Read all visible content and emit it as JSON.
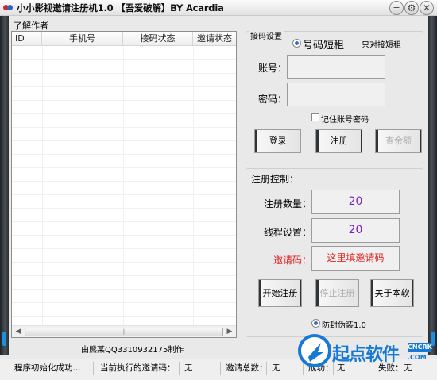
{
  "window": {
    "title": "小小影视邀请注册机1.0 【吾爱破解】BY Acardia",
    "buttons": [
      "−",
      "⚙",
      "✕"
    ]
  },
  "menu": {
    "items": [
      "了解作者"
    ]
  },
  "list": {
    "columns": [
      "ID",
      "手机号",
      "接码状态",
      "邀请状态"
    ],
    "scroll_thumb": "|||"
  },
  "credit": "由熊某QQ3310932175制作",
  "login_panel": {
    "title": "接码设置",
    "radio_sms": "号码短租",
    "radio_only": "只对接短租",
    "account_label": "账号：",
    "password_label": "密码：",
    "account_value": "",
    "password_value": "",
    "remember_label": "记住账号密码",
    "login_button": "登录",
    "register_button": "注册",
    "balance_button": "查余额"
  },
  "register_panel": {
    "title": "注册控制：",
    "count_label": "注册数量：",
    "count_value": "20",
    "thread_label": "线程设置：",
    "thread_value": "20",
    "invite_label": "邀请码：",
    "invite_value": "这里填邀请码",
    "start_button": "开始注册",
    "stop_button": "停止注册",
    "about_button": "关于本软",
    "antifake_label": "防封伪装1.0"
  },
  "status": {
    "message": "程序初始化成功...",
    "current_invite_label": "当前执行的邀请码：",
    "current_invite_value": "无",
    "invite_total_label": "邀请总数：",
    "invite_total_value": "无",
    "success_label": "成功：",
    "success_value": "无",
    "fail_label": "失败：",
    "fail_value": "无"
  },
  "watermark": {
    "brand": "起点软件",
    "badge": "CNCRK",
    "domain": ".COM"
  },
  "colors": {
    "value_purple": "#7a1fb8",
    "invite_red": "#e02020",
    "frame_dark": "#2f3438",
    "accent_blue": "#1679d6"
  }
}
